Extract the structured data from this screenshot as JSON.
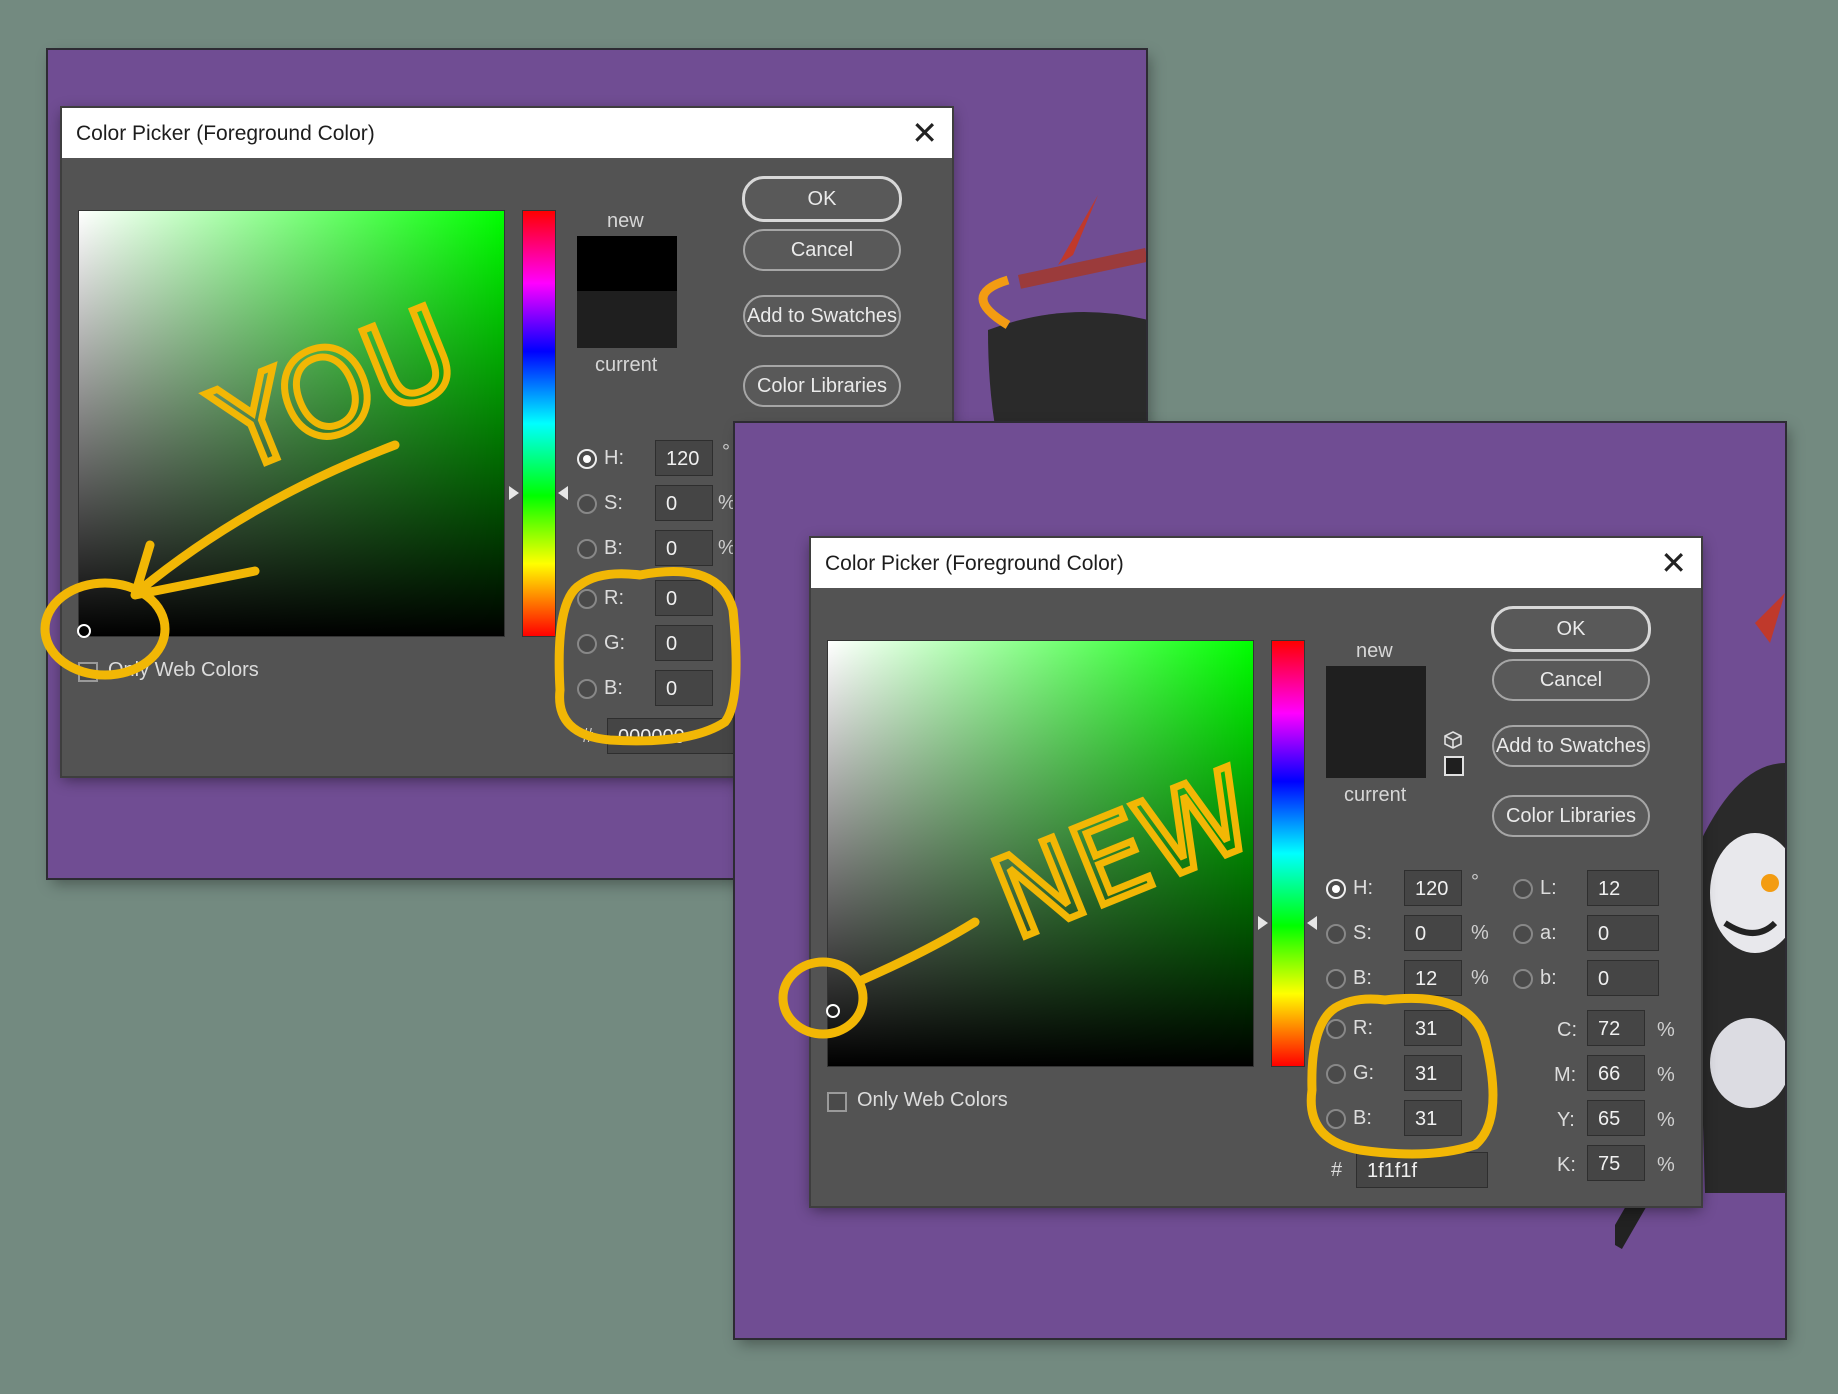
{
  "dialog1": {
    "title": "Color Picker (Foreground Color)",
    "close": "✕",
    "new_label": "new",
    "current_label": "current",
    "new_color": "#000000",
    "current_color": "#1f1f1f",
    "buttons": {
      "ok": "OK",
      "cancel": "Cancel",
      "swatches": "Add to Swatches",
      "libraries": "Color Libraries"
    },
    "fields": {
      "h_label": "H:",
      "h_value": "120",
      "h_unit": "°",
      "s_label": "S:",
      "s_value": "0",
      "s_unit": "%",
      "b_label": "B:",
      "b_value": "0",
      "b_unit": "%",
      "r_label": "R:",
      "r_value": "0",
      "g_label": "G:",
      "g_value": "0",
      "blue_label": "B:",
      "blue_value": "0",
      "hex_label": "#",
      "hex_value": "000000"
    },
    "only_web_colors": "Only Web Colors"
  },
  "dialog2": {
    "title": "Color Picker (Foreground Color)",
    "close": "✕",
    "new_label": "new",
    "current_label": "current",
    "new_color": "#1f1f1f",
    "current_color": "#1f1f1f",
    "buttons": {
      "ok": "OK",
      "cancel": "Cancel",
      "swatches": "Add to Swatches",
      "libraries": "Color Libraries"
    },
    "fields": {
      "h_label": "H:",
      "h_value": "120",
      "h_unit": "°",
      "s_label": "S:",
      "s_value": "0",
      "s_unit": "%",
      "b_label": "B:",
      "b_value": "12",
      "b_unit": "%",
      "r_label": "R:",
      "r_value": "31",
      "g_label": "G:",
      "g_value": "31",
      "blue_label": "B:",
      "blue_value": "31",
      "l_label": "L:",
      "l_value": "12",
      "a_label": "a:",
      "a_value": "0",
      "lab_b_label": "b:",
      "lab_b_value": "0",
      "c_label": "C:",
      "c_value": "72",
      "c_unit": "%",
      "m_label": "M:",
      "m_value": "66",
      "m_unit": "%",
      "y_label": "Y:",
      "y_value": "65",
      "y_unit": "%",
      "k_label": "K:",
      "k_value": "75",
      "k_unit": "%",
      "hex_label": "#",
      "hex_value": "1f1f1f"
    },
    "only_web_colors": "Only Web Colors"
  },
  "annotations": {
    "word1": "YOU",
    "word2": "NEW",
    "color": "#f2b705"
  },
  "colors": {
    "background": "#738a80",
    "canvas": "#704d93",
    "dialog": "#535353"
  }
}
